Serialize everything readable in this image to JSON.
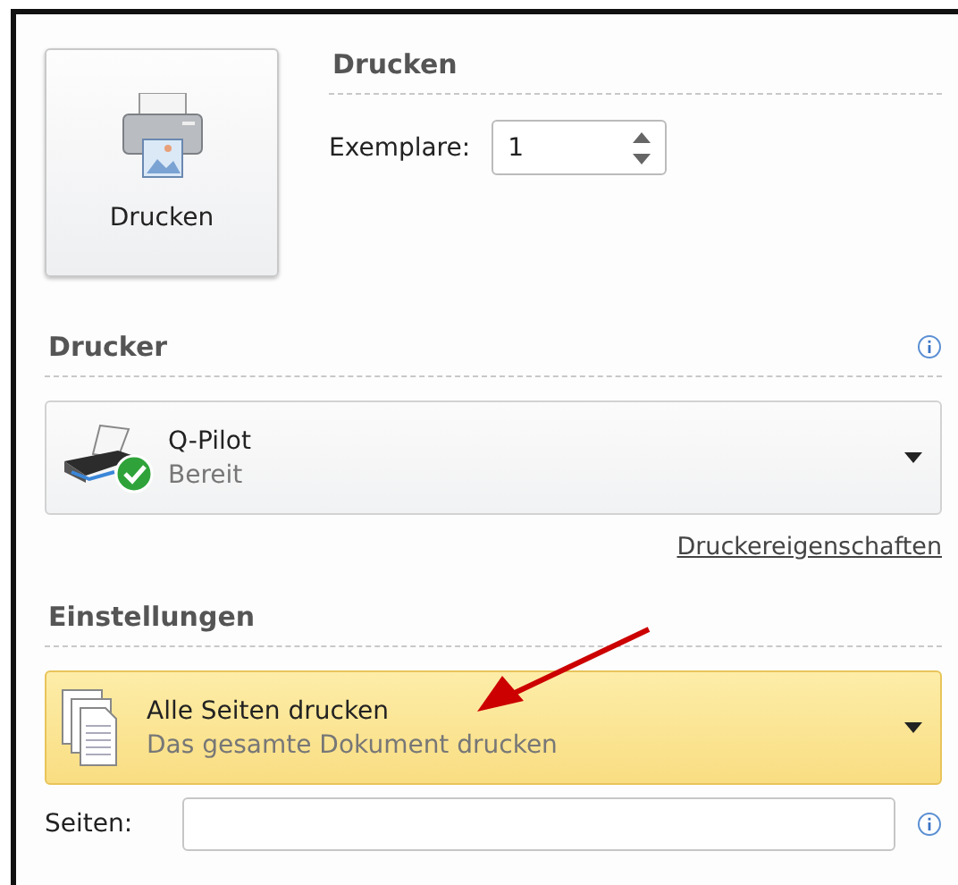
{
  "print_button": {
    "label": "Drucken"
  },
  "print_section": {
    "title": "Drucken",
    "copies": {
      "label": "Exemplare:",
      "value": "1"
    }
  },
  "printer_section": {
    "title": "Drucker",
    "printer": {
      "name": "Q-Pilot",
      "status": "Bereit"
    },
    "properties_link": "Druckereigenschaften"
  },
  "settings_section": {
    "title": "Einstellungen",
    "range": {
      "title": "Alle Seiten drucken",
      "subtitle": "Das gesamte Dokument drucken",
      "highlighted": true
    },
    "pages": {
      "label": "Seiten:"
    }
  }
}
